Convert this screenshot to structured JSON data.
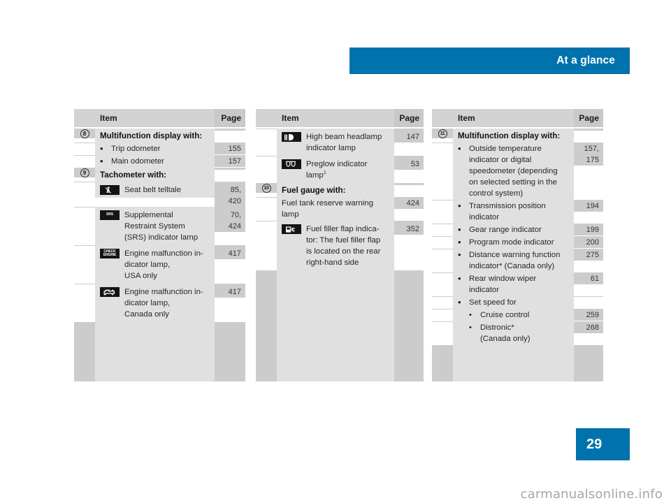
{
  "header": {
    "title": "At a glance",
    "accent_color": "#0072ad"
  },
  "footer": {
    "page_number": "29",
    "watermark": "carmanualsonline.info"
  },
  "colors": {
    "accent": "#0072ad",
    "table_item_bg": "#e0e0e0",
    "table_page_bg": "#cccccc",
    "table_header_bg": "#d3d3d3",
    "icon_bg": "#141414",
    "text": "#262626"
  },
  "tables": [
    {
      "id": "table-left",
      "columns": {
        "item": "Item",
        "page": "Page"
      },
      "rows": [
        {
          "type": "heading",
          "marker": "8",
          "text": "Multifunction display with:",
          "page": ""
        },
        {
          "type": "bullet",
          "marker": "",
          "text": "Trip odometer",
          "page": "155"
        },
        {
          "type": "bullet",
          "marker": "",
          "text": "Main odometer",
          "page": "157"
        },
        {
          "type": "heading",
          "marker": "9",
          "text": "Tachometer with:",
          "page": ""
        },
        {
          "type": "icon",
          "icon": "seat-belt-telltale-icon",
          "text": "Seat belt telltale",
          "page": "85,\n420"
        },
        {
          "type": "icon",
          "icon": "srs-indicator-icon",
          "text": "Supplemental\nRestraint System\n(SRS) indicator lamp",
          "page": "70,\n424"
        },
        {
          "type": "icon",
          "icon": "check-engine-icon",
          "text": "Engine malfunction in-\ndicator lamp,\nUSA only",
          "page": "417"
        },
        {
          "type": "icon",
          "icon": "engine-outline-icon",
          "text": "Engine malfunction in-\ndicator lamp,\nCanada only",
          "page": "417"
        }
      ]
    },
    {
      "id": "table-middle",
      "columns": {
        "item": "Item",
        "page": "Page"
      },
      "rows": [
        {
          "type": "icon",
          "icon": "high-beam-headlamp-icon",
          "text": "High beam headlamp\nindicator lamp",
          "page": "147"
        },
        {
          "type": "icon",
          "icon": "preglow-indicator-icon",
          "text": "Preglow indicator\nlamp",
          "text_sup": "1",
          "page": "53"
        },
        {
          "type": "heading",
          "marker": "10",
          "text": "Fuel gauge with:",
          "page": ""
        },
        {
          "type": "plain",
          "text": "Fuel tank reserve warning\nlamp",
          "page": "424"
        },
        {
          "type": "icon",
          "icon": "fuel-filler-flap-icon",
          "text": "Fuel filler flap indica-\ntor: The fuel filler flap\nis located on the rear\nright-hand side",
          "page": "352"
        }
      ]
    },
    {
      "id": "table-right",
      "columns": {
        "item": "Item",
        "page": "Page"
      },
      "rows": [
        {
          "type": "heading",
          "marker": "11",
          "text": "Multifunction display with:",
          "page": ""
        },
        {
          "type": "bullet",
          "text": "Outside temperature\nindicator or digital\nspeedometer (depending\non selected setting in the\ncontrol system)",
          "page": "157,\n175"
        },
        {
          "type": "bullet",
          "text": "Transmission position\nindicator",
          "page": "194"
        },
        {
          "type": "bullet",
          "text": "Gear range indicator",
          "page": "199"
        },
        {
          "type": "bullet",
          "text": "Program mode indicator",
          "page": "200"
        },
        {
          "type": "bullet",
          "text": "Distance warning function\nindicator* (Canada only)",
          "page": "275"
        },
        {
          "type": "bullet",
          "text": "Rear window wiper\nindicator",
          "page": "61"
        },
        {
          "type": "bullet",
          "text": "Set speed for",
          "page": ""
        },
        {
          "type": "subbullet",
          "text": "Cruise control",
          "page": "259"
        },
        {
          "type": "subbullet",
          "text": "Distronic*\n(Canada only)",
          "page": "268"
        }
      ]
    }
  ],
  "icons": {
    "seat-belt-telltale-icon": "seated person with seat belt",
    "srs-indicator-icon": "SRS",
    "check-engine-icon": "CHECK ENGINE",
    "engine-outline-icon": "engine block outline",
    "high-beam-headlamp-icon": "high beam headlamp",
    "preglow-indicator-icon": "preglow coils",
    "fuel-filler-flap-icon": "fuel pump / filler flap"
  }
}
